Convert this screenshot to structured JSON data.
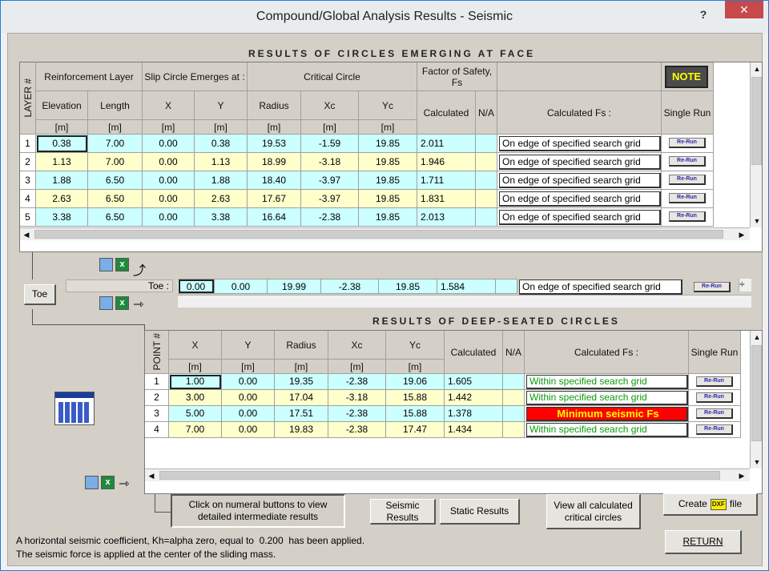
{
  "window": {
    "title": "Compound/Global Analysis Results - Seismic",
    "help": "?",
    "close": "✕"
  },
  "face": {
    "heading": "RESULTS OF CIRCLES EMERGING AT FACE",
    "headers": {
      "layer": "LAYER #",
      "reinforcement": "Reinforcement Layer",
      "slip": "Slip Circle Emerges at :",
      "critical": "Critical Circle",
      "fs": "Factor of Safety, Fs",
      "elevation": "Elevation",
      "length": "Length",
      "x": "X",
      "y": "Y",
      "radius": "Radius",
      "xc": "Xc",
      "yc": "Yc",
      "calculated": "Calculated",
      "na": "N/A",
      "calc_fs": "Calculated Fs :",
      "single_run": "Single Run",
      "unit": "[m]"
    },
    "note_label": "NOTE",
    "rows": [
      {
        "n": "1",
        "elev": "0.38",
        "len": "7.00",
        "x": "0.00",
        "y": "0.38",
        "r": "19.53",
        "xc": "-1.59",
        "yc": "19.85",
        "fs": "2.011",
        "status": "On edge of specified search grid"
      },
      {
        "n": "2",
        "elev": "1.13",
        "len": "7.00",
        "x": "0.00",
        "y": "1.13",
        "r": "18.99",
        "xc": "-3.18",
        "yc": "19.85",
        "fs": "1.946",
        "status": "On edge of specified search grid"
      },
      {
        "n": "3",
        "elev": "1.88",
        "len": "6.50",
        "x": "0.00",
        "y": "1.88",
        "r": "18.40",
        "xc": "-3.97",
        "yc": "19.85",
        "fs": "1.711",
        "status": "On edge of specified search grid"
      },
      {
        "n": "4",
        "elev": "2.63",
        "len": "6.50",
        "x": "0.00",
        "y": "2.63",
        "r": "17.67",
        "xc": "-3.97",
        "yc": "19.85",
        "fs": "1.831",
        "status": "On edge of specified search grid"
      },
      {
        "n": "5",
        "elev": "3.38",
        "len": "6.50",
        "x": "0.00",
        "y": "3.38",
        "r": "16.64",
        "xc": "-2.38",
        "yc": "19.85",
        "fs": "2.013",
        "status": "On edge of specified search grid"
      }
    ],
    "rerun": "Re-Run"
  },
  "toe": {
    "button": "Toe",
    "label": "Toe :",
    "x": "0.00",
    "y": "0.00",
    "r": "19.99",
    "xc": "-2.38",
    "yc": "19.85",
    "fs": "1.584",
    "status": "On edge of specified search grid"
  },
  "deep": {
    "heading": "RESULTS OF DEEP-SEATED CIRCLES",
    "headers": {
      "point": "POINT #",
      "x": "X",
      "y": "Y",
      "radius": "Radius",
      "xc": "Xc",
      "yc": "Yc",
      "calculated": "Calculated",
      "na": "N/A",
      "calc_fs": "Calculated Fs :",
      "single_run": "Single Run",
      "unit": "[m]"
    },
    "rows": [
      {
        "n": "1",
        "x": "1.00",
        "y": "0.00",
        "r": "19.35",
        "xc": "-2.38",
        "yc": "19.06",
        "fs": "1.605",
        "status": "Within specified search grid"
      },
      {
        "n": "2",
        "x": "3.00",
        "y": "0.00",
        "r": "17.04",
        "xc": "-3.18",
        "yc": "15.88",
        "fs": "1.442",
        "status": "Within specified search grid"
      },
      {
        "n": "3",
        "x": "5.00",
        "y": "0.00",
        "r": "17.51",
        "xc": "-2.38",
        "yc": "15.88",
        "fs": "1.378",
        "status": "Minimum seismic Fs"
      },
      {
        "n": "4",
        "x": "7.00",
        "y": "0.00",
        "r": "19.83",
        "xc": "-2.38",
        "yc": "17.47",
        "fs": "1.434",
        "status": "Within specified search grid"
      }
    ]
  },
  "bottom": {
    "hint": "Click on numeral buttons to view detailed intermediate results",
    "seismic": "Seismic Results",
    "static": "Static Results",
    "view_all": "View all calculated critical circles",
    "create_pre": "Create",
    "create_icon": "DXF",
    "create_post": "file",
    "return": "RETURN",
    "footnote1": "A horizontal seismic coefficient, Kh=alpha zero, equal to  0.200  has been applied.",
    "footnote2": "The seismic force is applied at the center of the sliding mass."
  },
  "icons": {
    "print": "printer-icon",
    "excel": "excel-icon",
    "calc": "calculator-icon",
    "arrow": "arrow-icon"
  },
  "colors": {
    "cyan_row": "#ccffff",
    "yellow_row": "#ffffcc",
    "status_green": "#0a9a0a",
    "min_fs_bg": "#ff0000",
    "min_fs_text": "#ffff00",
    "note_text": "#ffff00"
  }
}
